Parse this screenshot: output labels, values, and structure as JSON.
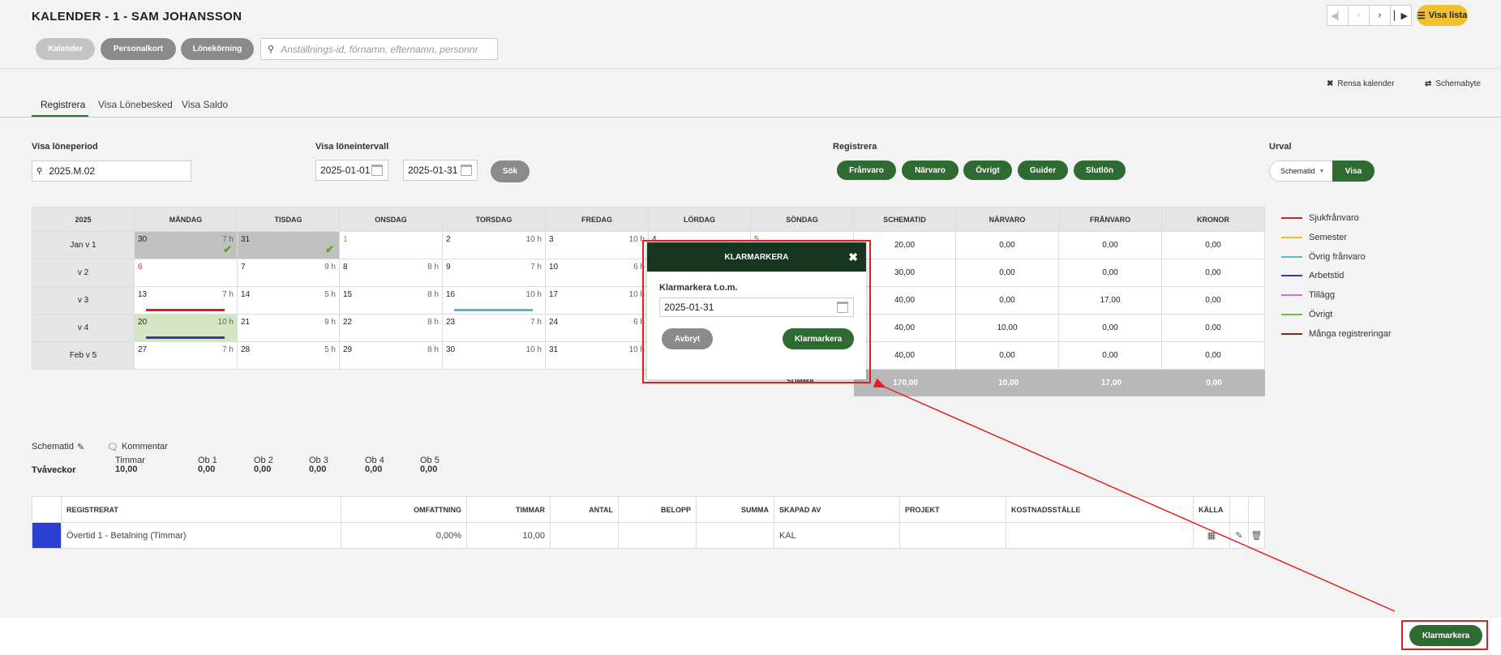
{
  "header": {
    "title": "KALENDER - 1 - SAM JOHANSSON",
    "buttons": {
      "kalender": "Kalender",
      "personalkort": "Personalkort",
      "lonekorning": "Lönekörning"
    },
    "search_placeholder": "Anställnings-id, förnamn, efternamn, personnr",
    "visa_lista": "Visa lista"
  },
  "toplinks": {
    "rensa": "Rensa kalender",
    "schemabyte": "Schemabyte"
  },
  "tabs": [
    "Registrera",
    "Visa Lönebesked",
    "Visa Saldo"
  ],
  "filters": {
    "loneperiod_label": "Visa löneperiod",
    "loneperiod_value": "2025.M.02",
    "loneintervall_label": "Visa löneintervall",
    "from_date": "2025-01-01",
    "to_date": "2025-01-31",
    "sok": "Sök",
    "registrera_label": "Registrera",
    "registrera_buttons": [
      "Frånvaro",
      "Närvaro",
      "Övrigt",
      "Guider",
      "Slutlön"
    ],
    "urval_label": "Urval",
    "urval_select": "Schematid",
    "urval_visa": "Visa"
  },
  "calendar": {
    "headers": [
      "2025",
      "MÅNDAG",
      "TISDAG",
      "ONSDAG",
      "TORSDAG",
      "FREDAG",
      "LÖRDAG",
      "SÖNDAG",
      "SCHEMATID",
      "NÄRVARO",
      "FRÅNVARO",
      "KRONOR"
    ],
    "weeks": [
      {
        "label": "Jan v 1",
        "days": [
          [
            "30",
            "7 h"
          ],
          [
            "31",
            ""
          ],
          [
            "1",
            ""
          ],
          [
            "2",
            "10 h"
          ],
          [
            "3",
            "10 h"
          ],
          [
            "4",
            ""
          ],
          [
            "5",
            ""
          ]
        ],
        "totals": [
          "20,00",
          "0,00",
          "0,00",
          "0,00"
        ]
      },
      {
        "label": "v 2",
        "days": [
          [
            "6",
            ""
          ],
          [
            "7",
            "9 h"
          ],
          [
            "8",
            "8 h"
          ],
          [
            "9",
            "7 h"
          ],
          [
            "10",
            "6 h"
          ],
          [
            "",
            ""
          ],
          [
            "",
            ""
          ]
        ],
        "totals": [
          "30,00",
          "0,00",
          "0,00",
          "0,00"
        ]
      },
      {
        "label": "v 3",
        "days": [
          [
            "13",
            "7 h"
          ],
          [
            "14",
            "5 h"
          ],
          [
            "15",
            "8 h"
          ],
          [
            "16",
            "10 h"
          ],
          [
            "17",
            "10 h"
          ],
          [
            "",
            ""
          ],
          [
            "",
            ""
          ]
        ],
        "totals": [
          "40,00",
          "0,00",
          "17,00",
          "0,00"
        ]
      },
      {
        "label": "v 4",
        "days": [
          [
            "20",
            "10 h"
          ],
          [
            "21",
            "9 h"
          ],
          [
            "22",
            "8 h"
          ],
          [
            "23",
            "7 h"
          ],
          [
            "24",
            "6 h"
          ],
          [
            "",
            ""
          ],
          [
            "",
            ""
          ]
        ],
        "totals": [
          "40,00",
          "10,00",
          "0,00",
          "0,00"
        ]
      },
      {
        "label": "Feb v 5",
        "days": [
          [
            "27",
            "7 h"
          ],
          [
            "28",
            "5 h"
          ],
          [
            "29",
            "8 h"
          ],
          [
            "30",
            "10 h"
          ],
          [
            "31",
            "10 h"
          ],
          [
            "",
            ""
          ],
          [
            "",
            ""
          ]
        ],
        "totals": [
          "40,00",
          "0,00",
          "0,00",
          "0,00"
        ]
      }
    ],
    "summa_label": "SUMMA",
    "summa": [
      "170,00",
      "10,00",
      "17,00",
      "0,00"
    ]
  },
  "legend": [
    {
      "label": "Sjukfrånvaro",
      "color": "#c62828"
    },
    {
      "label": "Semester",
      "color": "#e6c229"
    },
    {
      "label": "Övrig frånvaro",
      "color": "#5bb5d6"
    },
    {
      "label": "Arbetstid",
      "color": "#2a3fb0"
    },
    {
      "label": "Tillägg",
      "color": "#d670c9"
    },
    {
      "label": "Övrigt",
      "color": "#6cbf3a"
    },
    {
      "label": "Många registreringar",
      "color": "#7a2e14"
    }
  ],
  "modal": {
    "title": "KLARMARKERA",
    "field_label": "Klarmarkera t.o.m.",
    "field_value": "2025-01-31",
    "cancel": "Avbryt",
    "confirm": "Klarmarkera"
  },
  "schema": {
    "schematid": "Schematid",
    "kommentar": "Kommentar",
    "tvaveckor": "Tvåveckor",
    "cols": [
      {
        "label": "Timmar",
        "value": "10,00"
      },
      {
        "label": "Ob 1",
        "value": "0,00"
      },
      {
        "label": "Ob 2",
        "value": "0,00"
      },
      {
        "label": "Ob 3",
        "value": "0,00"
      },
      {
        "label": "Ob 4",
        "value": "0,00"
      },
      {
        "label": "Ob 5",
        "value": "0,00"
      }
    ]
  },
  "registrations": {
    "headers": [
      "REGISTRERAT",
      "OMFATTNING",
      "TIMMAR",
      "ANTAL",
      "BELOPP",
      "SUMMA",
      "SKAPAD AV",
      "PROJEKT",
      "KOSTNADSSTÄLLE",
      "KÄLLA"
    ],
    "rows": [
      {
        "registrerat": "Övertid 1 - Betalning (Timmar)",
        "omfattning": "0,00%",
        "timmar": "10,00",
        "antal": "",
        "belopp": "",
        "summa": "",
        "skapad_av": "KAL",
        "projekt": "",
        "kostnadsstalle": ""
      }
    ]
  },
  "footer": {
    "klarmarkera": "Klarmarkera"
  }
}
